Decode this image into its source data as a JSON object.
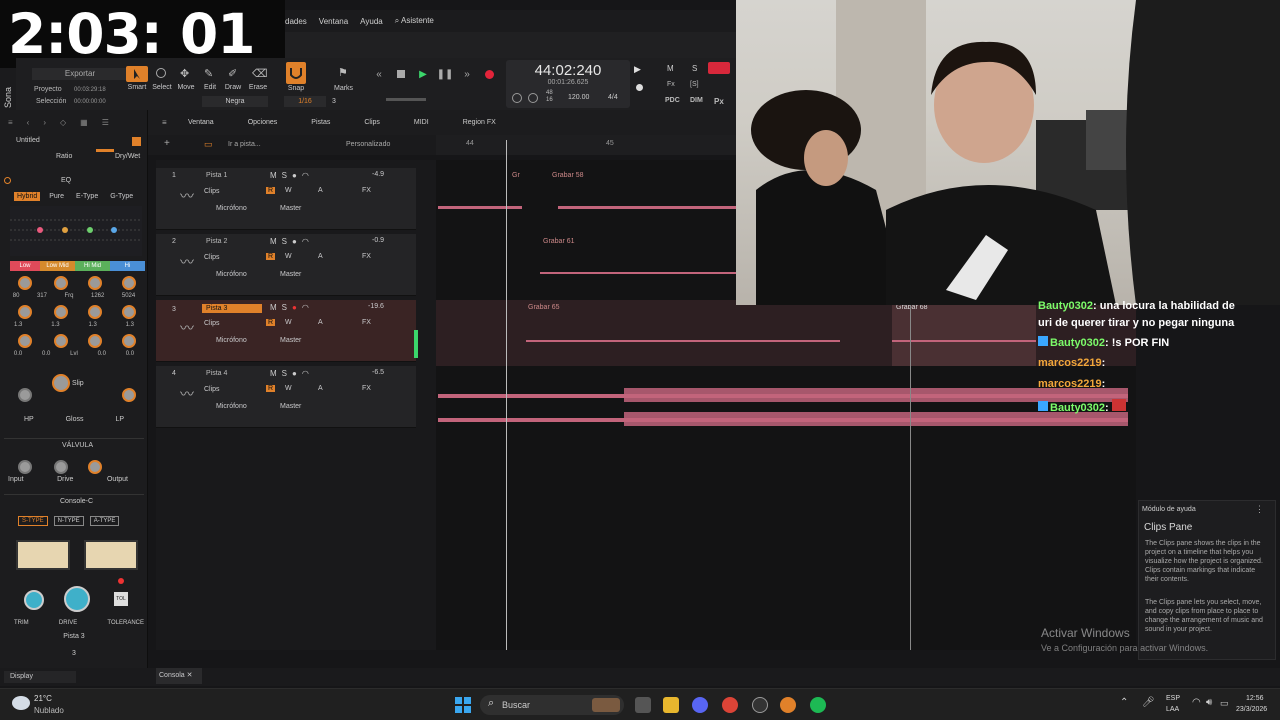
{
  "overlay_timer": "2:03: 01",
  "menu": {
    "items": [
      "dades",
      "Ventana",
      "Ayuda",
      "⌕ Asistente"
    ]
  },
  "sidebar_brand": "Sona",
  "toolbar": {
    "export_label": "Exportar",
    "project_label": "Proyecto",
    "project_time": "00:03:29:18",
    "selection_label": "Selección",
    "selection_time": "00:00:00:00",
    "tools": [
      "Smart",
      "Select",
      "Move",
      "Edit",
      "Draw",
      "Erase"
    ],
    "snap_label": "Snap",
    "snap_value": "1/16",
    "snap_count": "3",
    "marks_label": "Marks",
    "color_select": "Negra"
  },
  "transport": {
    "time_main": "44:02:240",
    "time_sub": "00:01:26.625",
    "beats_top": "48",
    "beats_bottom": "16",
    "tempo": "120.00",
    "meter": "4/4",
    "m_label": "M",
    "s_label": "S",
    "extras": [
      "Fx",
      "[S]",
      "PDC",
      "DIM",
      "Px"
    ]
  },
  "inspector": {
    "project_name": "Untitled",
    "ratio_label": "Ratio",
    "drywet_label": "Dry/Wet",
    "eq_label": "EQ",
    "eq_modes": [
      "Hybrid",
      "Pure",
      "E-Type",
      "G-Type"
    ],
    "bands": [
      "Low",
      "Low Mid",
      "Hi Mid",
      "Hi"
    ],
    "band_freqs": [
      "80",
      "317",
      "Frq",
      "1262",
      "5024"
    ],
    "band_gains": [
      "1.3",
      "1.3",
      "1.3",
      "1.3"
    ],
    "band_q": [
      "0.0",
      "0.0",
      "Lvl",
      "0.0",
      "0.0"
    ],
    "slip_label": "Slip",
    "filters": [
      "HP",
      "Gloss",
      "LP"
    ],
    "valve_label": "VÁLVULA",
    "valve_knobs": [
      "Input",
      "Drive",
      "Output"
    ],
    "console_label": "Console-C",
    "console_types": [
      "S-TYPE",
      "N-TYPE",
      "A-TYPE"
    ],
    "console_knobs": [
      "TRIM",
      "DRIVE",
      "TOLERANCE"
    ],
    "tol_label": "TOL",
    "track_name": "Pista 3",
    "track_num": "3",
    "display_label": "Display"
  },
  "track_view": {
    "menu": [
      "Ventana",
      "Opciones",
      "Pistas",
      "Clips",
      "MIDI",
      "Region FX"
    ],
    "goto": "Ir a pista...",
    "preset": "Personalizado",
    "ruler": [
      "44",
      "45"
    ]
  },
  "tracks": [
    {
      "num": "1",
      "name": "Pista 1",
      "vol": "-4.9",
      "clips": "Clips",
      "input": "Micrófono",
      "output": "Master",
      "clip_labels": [
        "Gr",
        "Grabar 58"
      ]
    },
    {
      "num": "2",
      "name": "Pista 2",
      "vol": "-0.9",
      "clips": "Clips",
      "input": "Micrófono",
      "output": "Master",
      "clip_labels": [
        "Grabar 61"
      ]
    },
    {
      "num": "3",
      "name": "Pista 3",
      "vol": "-19.6",
      "clips": "Clips",
      "input": "Micrófono",
      "output": "Master",
      "clip_labels": [
        "Grabar 65",
        "Grabar 68"
      ]
    },
    {
      "num": "4",
      "name": "Pista 4",
      "vol": "-6.5",
      "clips": "Clips",
      "input": "Micrófono",
      "output": "Master",
      "clip_labels": []
    }
  ],
  "track_buttons": {
    "m": "M",
    "s": "S",
    "r": "R",
    "w": "W",
    "a": "A",
    "fx": "FX"
  },
  "chat": [
    {
      "user": "Bauty0302",
      "text": ": una locura la habilidad de",
      "color": "#7cfc6a"
    },
    {
      "user": "",
      "text": "uri de querer tirar y no pegar ninguna",
      "color": "#ffffff"
    },
    {
      "user": "Bauty0302",
      "text": ": !s POR FIN",
      "color": "#7cfc6a"
    },
    {
      "user": "marcos2219",
      "text": ":",
      "color": "#f2a73a"
    },
    {
      "user": "marcos2219",
      "text": ":",
      "color": "#f2a73a"
    },
    {
      "user": "Bauty0302",
      "text": ":",
      "color": "#7cfc6a"
    }
  ],
  "help": {
    "module_label": "Módulo de ayuda",
    "title": "Clips Pane",
    "p1": "The Clips pane shows the clips in the project on a timeline that helps you visualize how the project is organized. Clips contain markings that indicate their contents.",
    "p2": "The Clips pane lets you select, move, and copy clips from place to place to change the arrangement of music and sound in your project."
  },
  "watermark": {
    "line1": "Activar Windows",
    "line2": "Ve a Configuración para activar Windows."
  },
  "console_tab": "Consola",
  "taskbar": {
    "weather_temp": "21°C",
    "weather_desc": "Nublado",
    "search_placeholder": "Buscar",
    "lang1": "ESP",
    "lang2": "LAA",
    "time": "12:56",
    "date": "23/3/2026"
  }
}
